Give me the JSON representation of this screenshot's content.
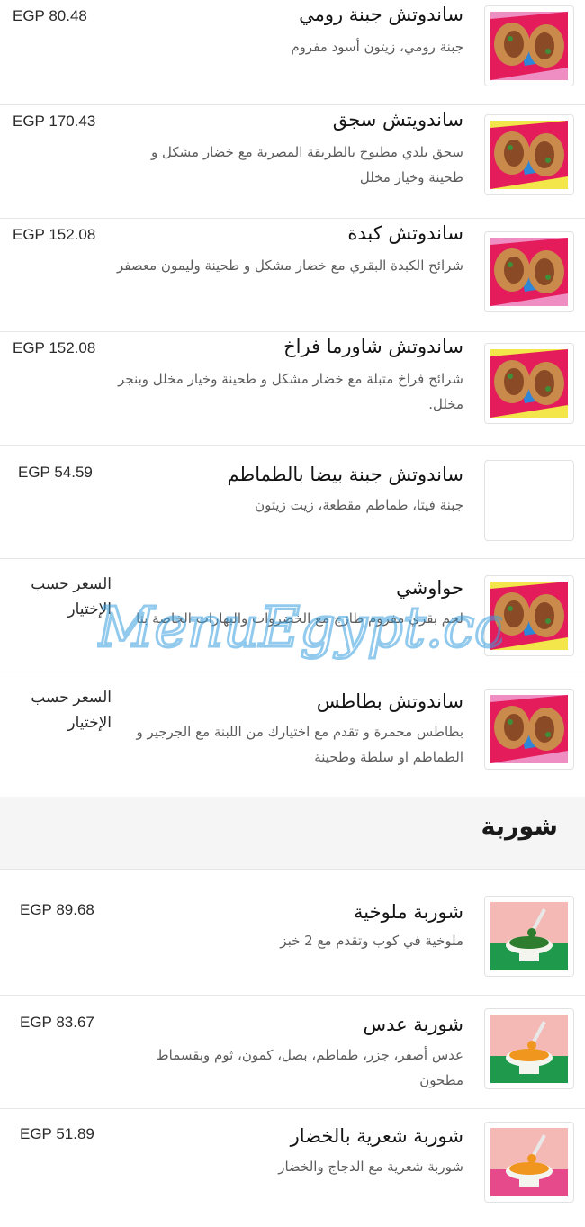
{
  "items": [
    {
      "name": "ساندوتش جبنة رومي",
      "desc": "جبنة رومي، زيتون أسود مفروم",
      "price": "EGP 80.48",
      "image": "sandwich-photo",
      "bg": "#ef8ec3",
      "band": "#e51c5b",
      "accent": "#2f86d6"
    },
    {
      "name": "ساندويتش سجق",
      "desc": "سجق بلدي مطبوخ بالطريقة المصرية مع خضار مشكل و طحينة وخيار مخلل",
      "price": "EGP 170.43",
      "image": "sandwich-photo",
      "bg": "#f2e64a",
      "band": "#e51c5b",
      "accent": "#2f86d6"
    },
    {
      "name": "ساندوتش كبدة",
      "desc": "شرائح الكبدة البقري مع خضار مشكل و طحينة وليمون معصفر",
      "price": "EGP 152.08",
      "image": "sandwich-photo",
      "bg": "#ef8ec3",
      "band": "#e51c5b",
      "accent": "#2f86d6"
    },
    {
      "name": "ساندوتش شاورما فراخ",
      "desc": "شرائح فراخ متبلة مع خضار مشكل و طحينة وخيار مخلل وبنجر مخلل.",
      "price": "EGP 152.08",
      "image": "sandwich-photo",
      "bg": "#f2e64a",
      "band": "#e51c5b",
      "accent": "#2f86d6"
    },
    {
      "name": "ساندوتش جبنة بيضا بالطماطم",
      "desc": "جبنة فيتا، طماطم مقطعة، زيت زيتون",
      "price": "EGP 54.59",
      "image": "",
      "bg": "",
      "band": "",
      "accent": ""
    },
    {
      "name": "حواوشي",
      "desc": "لحم بقري مفروم طازج مع الخضروات والبهارات الخاصة بنا",
      "price": "السعر حسب الإختيار",
      "image": "sandwich-photo",
      "bg": "#f2e64a",
      "band": "#e51c5b",
      "accent": "#2f86d6"
    },
    {
      "name": "ساندوتش بطاطس",
      "desc": "بطاطس محمرة و تقدم مع اختيارك من اللبنة مع الجرجير و الطماطم او سلطة وطحينة",
      "price": "السعر حسب الإختيار",
      "image": "sandwich-photo",
      "bg": "#ef8ec3",
      "band": "#e51c5b",
      "accent": "#2f86d6"
    }
  ],
  "section": {
    "title": "شوربة"
  },
  "soups": [
    {
      "name": "شوربة ملوخية",
      "desc": "ملوخية في كوب وتقدم مع 2 خبز",
      "price": "EGP 89.68",
      "image": "soup-photo",
      "bg": "#f4b8b5",
      "band": "#1f9a4c",
      "accent": "#2e7d2e"
    },
    {
      "name": "شوربة عدس",
      "desc": "عدس أصفر، جزر، طماطم، بصل، كمون، ثوم وبقسماط مطحون",
      "price": "EGP 83.67",
      "image": "soup-photo",
      "bg": "#f4b8b5",
      "band": "#1f9a4c",
      "accent": "#f0951e"
    },
    {
      "name": "شوربة شعرية بالخضار",
      "desc": "شوربة شعرية مع الدجاج والخضار",
      "price": "EGP 51.89",
      "image": "soup-photo",
      "bg": "#f4b8b5",
      "band": "#e64a8b",
      "accent": "#f0951e"
    }
  ],
  "watermark": {
    "text": "MenuEgypt.com",
    "color": "#3aa0e0"
  }
}
